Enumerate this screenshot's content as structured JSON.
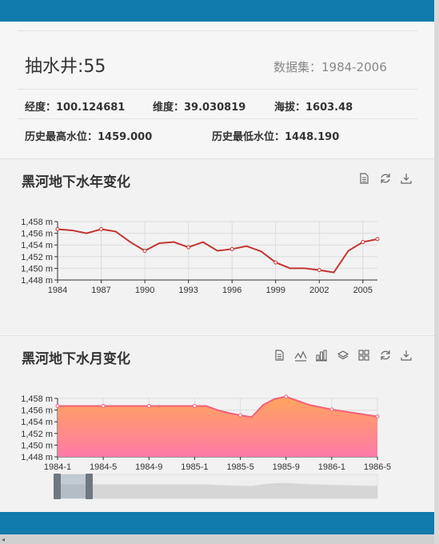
{
  "header": {
    "well_title": "抽水井:55",
    "dataset": "数据集：1984-2006"
  },
  "info": {
    "longitude": "经度：100.124681",
    "latitude": "维度：39.030819",
    "altitude": "海拔：1603.48",
    "max_level": "历史最高水位：1459.000",
    "min_level": "历史最低水位：1448.190"
  },
  "yearly_chart": {
    "title": "黑河地下水年变化",
    "toolbox": [
      "data-view-icon",
      "restore-icon",
      "save-image-icon"
    ]
  },
  "monthly_chart": {
    "title": "黑河地下水月变化",
    "toolbox": [
      "data-view-icon",
      "line-chart-icon",
      "bar-chart-icon",
      "stack-icon",
      "tiled-icon",
      "restore-icon",
      "save-image-icon"
    ]
  },
  "colors": {
    "top_bar": "#0f7aab",
    "line": "#c23531",
    "area_top": "#ffa55c",
    "area_bottom": "#ff7aa8",
    "area_line": "#f25f7a"
  },
  "chart_data": [
    {
      "type": "line",
      "title": "黑河地下水年变化",
      "x": [
        1984,
        1985,
        1986,
        1987,
        1988,
        1989,
        1990,
        1991,
        1992,
        1993,
        1994,
        1995,
        1996,
        1997,
        1998,
        1999,
        2000,
        2001,
        2002,
        2003,
        2004,
        2005,
        2006
      ],
      "x_ticks": [
        "1984",
        "1987",
        "1990",
        "1993",
        "1996",
        "1999",
        "2002",
        "2005"
      ],
      "y": [
        1456.7,
        1456.5,
        1456.0,
        1456.7,
        1456.3,
        1454.5,
        1453.0,
        1454.3,
        1454.5,
        1453.6,
        1454.5,
        1453.0,
        1453.3,
        1453.8,
        1452.9,
        1451.0,
        1450.0,
        1450.0,
        1449.7,
        1449.3,
        1453.0,
        1454.5,
        1455.0
      ],
      "ylim": [
        1448,
        1458
      ],
      "y_ticks": [
        "1,448 m",
        "1,450 m",
        "1,452 m",
        "1,454 m",
        "1,456 m",
        "1,458 m"
      ],
      "grid": true
    },
    {
      "type": "area",
      "title": "黑河地下水月变化",
      "x": [
        "1984-1",
        "1984-2",
        "1984-3",
        "1984-4",
        "1984-5",
        "1984-6",
        "1984-7",
        "1984-8",
        "1984-9",
        "1984-10",
        "1984-11",
        "1984-12",
        "1985-1",
        "1985-2",
        "1985-3",
        "1985-4",
        "1985-5",
        "1985-6",
        "1985-7",
        "1985-8",
        "1985-9",
        "1985-10",
        "1985-11",
        "1985-12",
        "1986-1",
        "1986-2",
        "1986-3",
        "1986-4",
        "1986-5"
      ],
      "x_ticks": [
        "1984-1",
        "1984-5",
        "1984-9",
        "1985-1",
        "1985-5",
        "1985-9",
        "1986-1",
        "1986-5"
      ],
      "y": [
        1456.7,
        1456.7,
        1456.7,
        1456.7,
        1456.7,
        1456.7,
        1456.7,
        1456.7,
        1456.7,
        1456.7,
        1456.7,
        1456.7,
        1456.7,
        1456.7,
        1456.0,
        1455.5,
        1455.1,
        1454.8,
        1456.9,
        1457.9,
        1458.3,
        1457.6,
        1456.9,
        1456.5,
        1456.1,
        1455.8,
        1455.5,
        1455.2,
        1454.9
      ],
      "ylim": [
        1448,
        1458
      ],
      "y_ticks": [
        "1,448 m",
        "1,450 m",
        "1,452 m",
        "1,454 m",
        "1,456 m",
        "1,458 m"
      ],
      "grid": true,
      "datazoom": {
        "start": 0,
        "end": 0.1
      }
    }
  ]
}
